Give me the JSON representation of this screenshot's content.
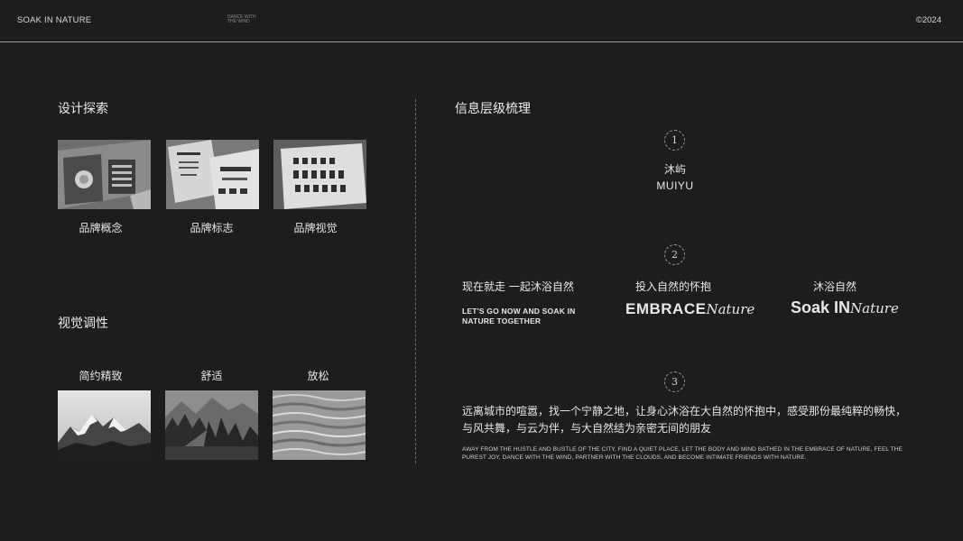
{
  "header": {
    "brand": "SOAK IN NATURE",
    "tagline_line1": "DANCE WITH",
    "tagline_line2": "THE WIND",
    "year": "©2024"
  },
  "left": {
    "design_section": {
      "title": "设计探索",
      "items": [
        {
          "label": "品牌概念"
        },
        {
          "label": "品牌标志"
        },
        {
          "label": "品牌视觉"
        }
      ]
    },
    "visual_section": {
      "title": "视觉调性",
      "items": [
        {
          "label": "简约精致"
        },
        {
          "label": "舒适"
        },
        {
          "label": "放松"
        }
      ]
    }
  },
  "right": {
    "title": "信息层级梳理",
    "step1": {
      "number": "1",
      "cn": "沐屿",
      "en": "MUIYU"
    },
    "step2": {
      "number": "2",
      "col1": {
        "cn": "现在就走 一起沐浴自然",
        "en": "LET'S GO NOW AND SOAK IN NATURE TOGETHER"
      },
      "col2": {
        "cn": "投入自然的怀抱",
        "logo_bold": "EMBRACE",
        "logo_script": "Nature"
      },
      "col3": {
        "cn": "沐浴自然",
        "logo_bold": "Soak IN",
        "logo_script": "Nature"
      }
    },
    "step3": {
      "number": "3",
      "cn": "远离城市的喧嚣，找一个宁静之地，让身心沐浴在大自然的怀抱中，感受那份最纯粹的畅快，与风共舞，与云为伴，与大自然结为亲密无间的朋友",
      "en": "AWAY FROM THE HUSTLE AND BUSTLE OF THE CITY, FIND A QUIET PLACE, LET THE BODY AND MIND BATHED IN THE EMBRACE OF NATURE, FEEL THE PUREST JOY, DANCE WITH THE WIND, PARTNER WITH THE CLOUDS, AND BECOME INTIMATE FRIENDS WITH NATURE."
    }
  }
}
